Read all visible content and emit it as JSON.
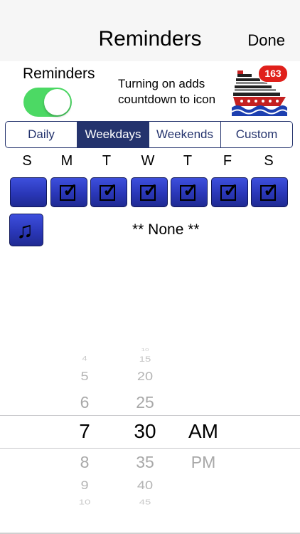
{
  "nav": {
    "title": "Reminders",
    "done_label": "Done"
  },
  "reminders": {
    "label": "Reminders",
    "enabled": true,
    "description": "Turning on adds countdown to icon",
    "badge_count": "163"
  },
  "schedule_tabs": [
    {
      "label": "Daily",
      "selected": false
    },
    {
      "label": "Weekdays",
      "selected": true
    },
    {
      "label": "Weekends",
      "selected": false
    },
    {
      "label": "Custom",
      "selected": false
    }
  ],
  "days": [
    {
      "letter": "S",
      "checked": false
    },
    {
      "letter": "M",
      "checked": true
    },
    {
      "letter": "T",
      "checked": true
    },
    {
      "letter": "W",
      "checked": true
    },
    {
      "letter": "T",
      "checked": true
    },
    {
      "letter": "F",
      "checked": true
    },
    {
      "letter": "S",
      "checked": true
    }
  ],
  "sound": {
    "name": "** None **"
  },
  "picker": {
    "hours": [
      "4",
      "5",
      "6",
      "7",
      "8",
      "9",
      "10"
    ],
    "minutes": [
      "10",
      "15",
      "20",
      "25",
      "30",
      "35",
      "40",
      "45"
    ],
    "period": [
      "AM",
      "PM"
    ],
    "selected": {
      "hour": "7",
      "minute": "30",
      "period": "AM"
    }
  }
}
